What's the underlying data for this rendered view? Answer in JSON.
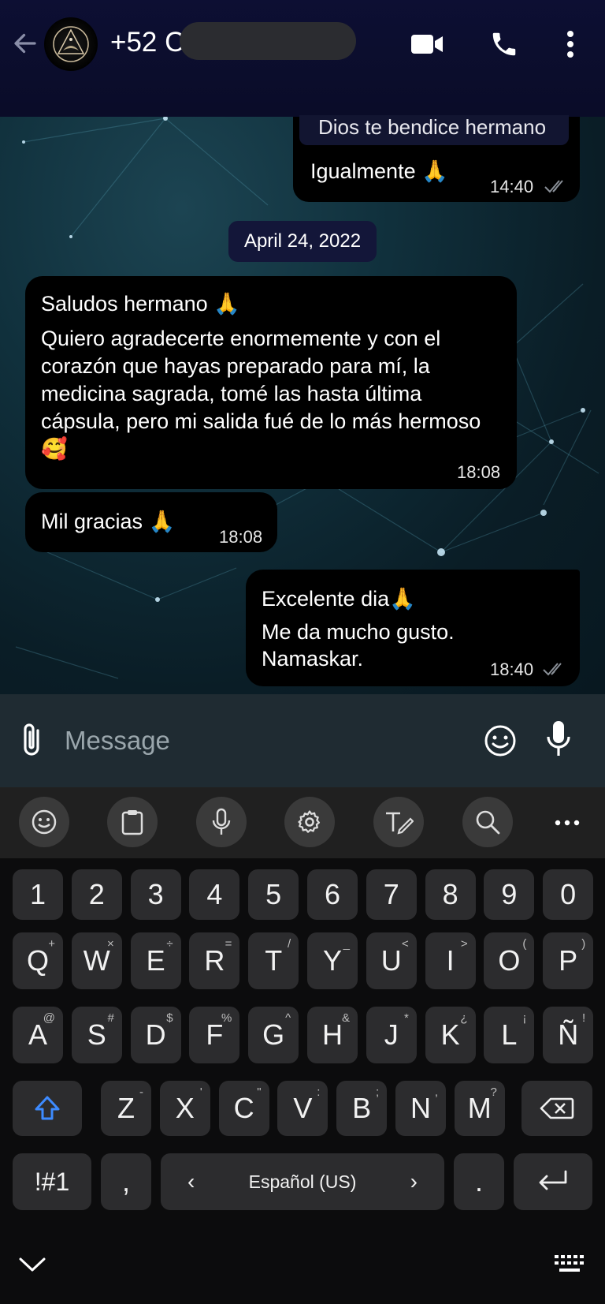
{
  "header": {
    "contact_name": "+52 C",
    "icons": {
      "back": "arrow-left-icon",
      "video": "video-call-icon",
      "call": "phone-icon",
      "more": "more-vertical-icon"
    }
  },
  "messages": {
    "quoted_text": "Dios te bendice hermano",
    "m1": {
      "text": "Igualmente 🙏",
      "time": "14:40"
    },
    "date_chip": "April 24, 2022",
    "m2": {
      "line1": "Saludos hermano 🙏",
      "body": "Quiero agradecerte enormemente y con el corazón que hayas preparado para mí, la medicina sagrada, tomé las hasta última cápsula, pero mi salida fué de lo más hermoso 🥰",
      "time": "18:08"
    },
    "m3": {
      "text": "Mil gracias 🙏",
      "time": "18:08"
    },
    "m4": {
      "line1": "Excelente dia🙏",
      "line2": "Me da mucho gusto.",
      "line3": "Namaskar.",
      "time": "18:40"
    }
  },
  "composer": {
    "placeholder": "Message"
  },
  "keyboard": {
    "number_row": [
      "1",
      "2",
      "3",
      "4",
      "5",
      "6",
      "7",
      "8",
      "9",
      "0"
    ],
    "row1": [
      {
        "k": "Q",
        "s": "+"
      },
      {
        "k": "W",
        "s": "×"
      },
      {
        "k": "E",
        "s": "÷"
      },
      {
        "k": "R",
        "s": "="
      },
      {
        "k": "T",
        "s": "/"
      },
      {
        "k": "Y",
        "s": "_"
      },
      {
        "k": "U",
        "s": "<"
      },
      {
        "k": "I",
        "s": ">"
      },
      {
        "k": "O",
        "s": "("
      },
      {
        "k": "P",
        "s": ")"
      }
    ],
    "row2": [
      {
        "k": "A",
        "s": "@"
      },
      {
        "k": "S",
        "s": "#"
      },
      {
        "k": "D",
        "s": "$"
      },
      {
        "k": "F",
        "s": "%"
      },
      {
        "k": "G",
        "s": "^"
      },
      {
        "k": "H",
        "s": "&"
      },
      {
        "k": "J",
        "s": "*"
      },
      {
        "k": "K",
        "s": "¿"
      },
      {
        "k": "L",
        "s": "¡"
      },
      {
        "k": "Ñ",
        "s": "!"
      }
    ],
    "row3": [
      {
        "k": "Z",
        "s": "-"
      },
      {
        "k": "X",
        "s": "'"
      },
      {
        "k": "C",
        "s": "\""
      },
      {
        "k": "V",
        "s": ":"
      },
      {
        "k": "B",
        "s": ";"
      },
      {
        "k": "N",
        "s": ","
      },
      {
        "k": "M",
        "s": "?"
      }
    ],
    "symbols_key": "!#1",
    "comma_key": ",",
    "period_key": ".",
    "space_label": "Español (US)",
    "accent_color": "#3d8bff"
  }
}
